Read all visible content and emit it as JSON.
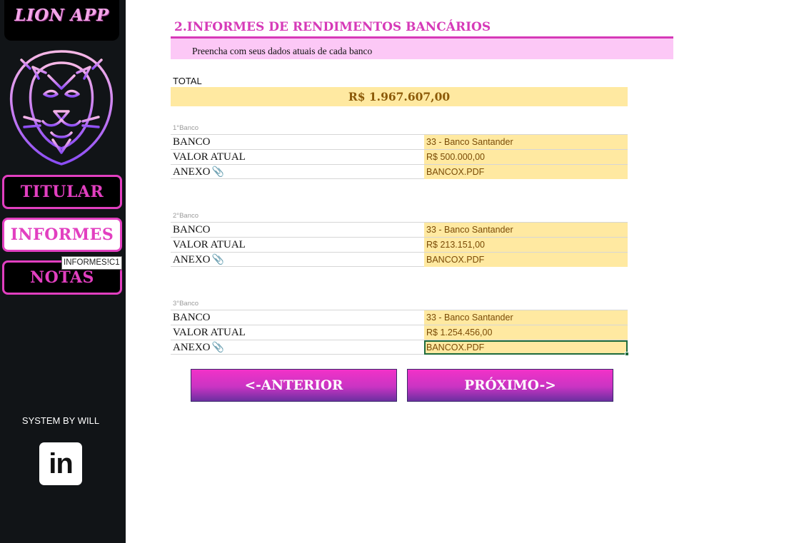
{
  "sidebar": {
    "logo": "LION APP",
    "nav": [
      {
        "label": "TITULAR",
        "active": false
      },
      {
        "label": "INFORMES",
        "active": true
      },
      {
        "label": "NOTAS",
        "active": false
      }
    ],
    "tooltip": "INFORMES!C1",
    "credit": "SYSTEM BY WILL",
    "social_icon": "linkedin-icon",
    "social_text": "in"
  },
  "main": {
    "title": "2.INFORMES DE RENDIMENTOS BANCÁRIOS",
    "subtitle": "Preencha com seus dados atuais de cada banco",
    "total_label": "TOTAL",
    "total_value": "R$ 1.967.607,00",
    "banks": [
      {
        "title": "1°Banco",
        "rows": [
          {
            "label": "BANCO",
            "value": "33 - Banco Santander"
          },
          {
            "label": "VALOR ATUAL",
            "value": "R$ 500.000,00"
          },
          {
            "label": "ANEXO",
            "value": "BANCOX.PDF"
          }
        ]
      },
      {
        "title": "2°Banco",
        "rows": [
          {
            "label": "BANCO",
            "value": "33 - Banco Santander"
          },
          {
            "label": "VALOR ATUAL",
            "value": "R$ 213.151,00"
          },
          {
            "label": "ANEXO",
            "value": "BANCOX.PDF"
          }
        ]
      },
      {
        "title": "3°Banco",
        "rows": [
          {
            "label": "BANCO",
            "value": "33 - Banco Santander"
          },
          {
            "label": "VALOR ATUAL",
            "value": "R$ 1.254.456,00"
          },
          {
            "label": "ANEXO",
            "value": "BANCOX.PDF"
          }
        ]
      }
    ],
    "prev_label": "<-ANTERIOR",
    "next_label": "PRÓXIMO->"
  },
  "colors": {
    "accent": "#d63ab8",
    "sidebar_bg": "#111417",
    "highlight": "#ffe9a1",
    "subtitle_band": "#fcc8f6"
  }
}
